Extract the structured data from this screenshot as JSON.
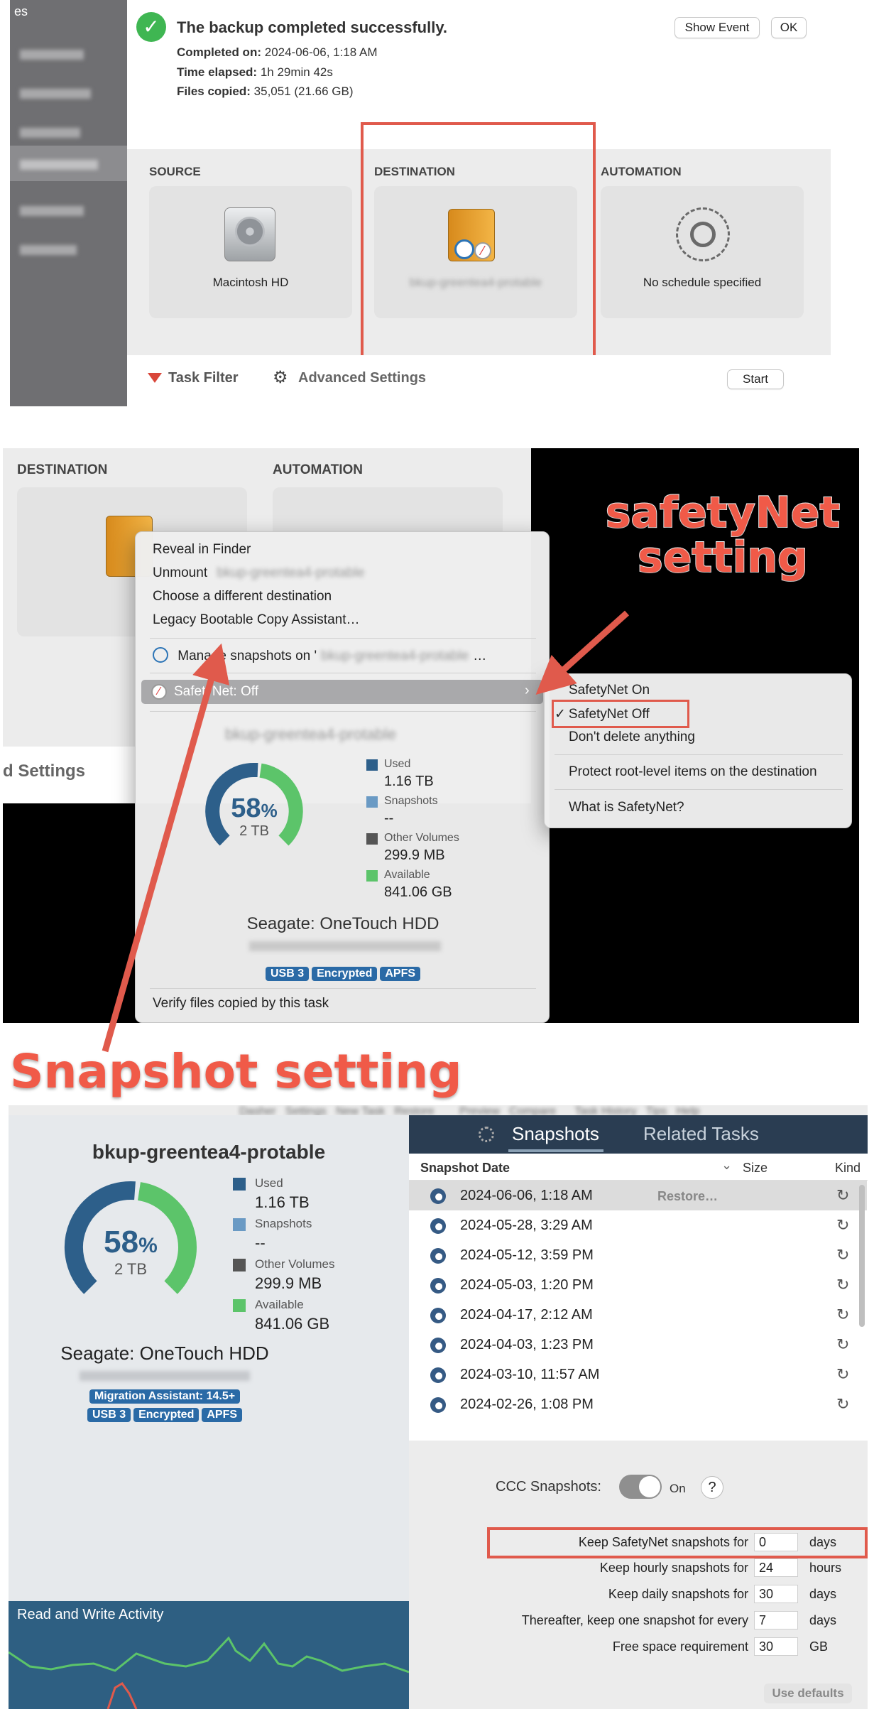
{
  "panel1": {
    "sidebar_corner": "es",
    "success_title": "The backup completed successfully.",
    "completed_label": "Completed on:",
    "completed_value": "2024-06-06, 1:18 AM",
    "elapsed_label": "Time elapsed:",
    "elapsed_value": "1h 29min 42s",
    "files_label": "Files copied:",
    "files_value": "35,051 (21.66 GB)",
    "show_event_label": "Show Event",
    "ok_label": "OK",
    "source_header": "SOURCE",
    "destination_header": "DESTINATION",
    "automation_header": "AUTOMATION",
    "source_name": "Macintosh HD",
    "destination_name": "bkup-greentea4-protable",
    "automation_name": "No schedule specified",
    "task_filter_label": "Task Filter",
    "advanced_settings_label": "Advanced Settings",
    "start_label": "Start",
    "accent_red": "#e05a4c"
  },
  "panel2": {
    "destination_header": "DESTINATION",
    "automation_header": "AUTOMATION",
    "settings_fragment": "d Settings",
    "menu": {
      "reveal": "Reveal in Finder",
      "unmount": "Unmount",
      "unmount_target": "bkup-greentea4-protable",
      "choose": "Choose a different destination",
      "legacy": "Legacy Bootable Copy Assistant…",
      "manage_prefix": "Manage snapshots on '",
      "manage_target": "bkup-greentea4-protable",
      "manage_suffix": "…",
      "safetynet": "SafetyNet: Off",
      "volume_name": "bkup-greentea4-protable",
      "percent": "58",
      "capacity": "2 TB",
      "used_label": "Used",
      "used_value": "1.16 TB",
      "snapshots_label": "Snapshots",
      "snapshots_value": "--",
      "other_label": "Other Volumes",
      "other_value": "299.9 MB",
      "available_label": "Available",
      "available_value": "841.06 GB",
      "device": "Seagate: OneTouch HDD",
      "tags": [
        "USB 3",
        "Encrypted",
        "APFS"
      ],
      "verify": "Verify files copied by this task"
    },
    "submenu": {
      "on": "SafetyNet On",
      "off": "SafetyNet Off",
      "dont_delete": "Don't delete anything",
      "protect": "Protect root-level items on the destination",
      "what": "What is SafetyNet?"
    },
    "annotation_safetynet": "safetyNet setting",
    "annotation_snapshot": "Snapshot setting",
    "gauge_used_fraction": 0.58,
    "colors": {
      "used": "#2d5f8a",
      "available": "#5cc46a",
      "other": "#555555",
      "snapshots": "#6a9ac4"
    }
  },
  "panel3": {
    "toolbar_labels": "Dasher   Settings   New Task   Restore        Preview   Compare      Task History   Tips   Help",
    "volume_name": "bkup-greentea4-protable",
    "percent": "58",
    "capacity": "2 TB",
    "used_label": "Used",
    "used_value": "1.16 TB",
    "snapshots_label": "Snapshots",
    "snapshots_value": "--",
    "other_label": "Other Volumes",
    "other_value": "299.9 MB",
    "available_label": "Available",
    "available_value": "841.06 GB",
    "device": "Seagate: OneTouch HDD",
    "migration_tag": "Migration Assistant: 14.5+",
    "tags": [
      "USB 3",
      "Encrypted",
      "APFS"
    ],
    "activity_label": "Read and Write Activity",
    "tabs": {
      "snapshots": "Snapshots",
      "related": "Related Tasks"
    },
    "columns": {
      "date": "Snapshot Date",
      "size": "Size",
      "kind": "Kind"
    },
    "snapshots": [
      "2024-06-06, 1:18 AM",
      "2024-05-28, 3:29 AM",
      "2024-05-12, 3:59 PM",
      "2024-05-03, 1:20 PM",
      "2024-04-17, 2:12 AM",
      "2024-04-03, 1:23 PM",
      "2024-03-10, 11:57 AM",
      "2024-02-26, 1:08 PM"
    ],
    "restore_label": "Restore…",
    "ccc_snapshots_label": "CCC Snapshots:",
    "toggle_state": "On",
    "help_label": "?",
    "settings": [
      {
        "label": "Keep SafetyNet snapshots for",
        "value": "0",
        "unit": "days"
      },
      {
        "label": "Keep hourly snapshots for",
        "value": "24",
        "unit": "hours"
      },
      {
        "label": "Keep daily snapshots for",
        "value": "30",
        "unit": "days"
      },
      {
        "label": "Thereafter, keep one snapshot for every",
        "value": "7",
        "unit": "days"
      },
      {
        "label": "Free space requirement",
        "value": "30",
        "unit": "GB"
      }
    ],
    "use_defaults_label": "Use defaults"
  }
}
